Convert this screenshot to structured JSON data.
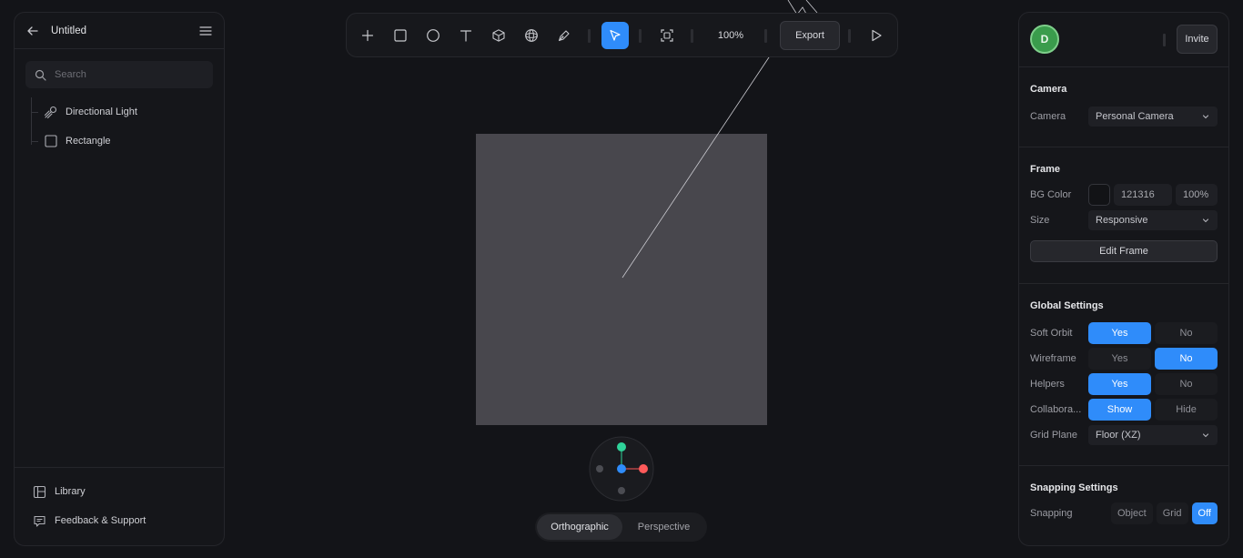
{
  "left_panel": {
    "title": "Untitled",
    "search_placeholder": "Search",
    "tree": [
      {
        "label": "Directional Light",
        "icon": "directional-light-icon"
      },
      {
        "label": "Rectangle",
        "icon": "rectangle-icon"
      }
    ],
    "footer": [
      {
        "label": "Library",
        "icon": "library-icon"
      },
      {
        "label": "Feedback & Support",
        "icon": "feedback-icon"
      }
    ]
  },
  "toolbar": {
    "tools": [
      "add-icon",
      "rectangle-tool-icon",
      "ellipse-tool-icon",
      "text-tool-icon",
      "cube-tool-icon",
      "sphere-tool-icon",
      "pen-tool-icon",
      "select-tool-icon",
      "frame-tool-icon"
    ],
    "active_tool": "select-tool-icon",
    "zoom": "100%",
    "export_label": "Export",
    "play_icon": "play-icon"
  },
  "canvas": {
    "plane_color": "#48474d",
    "background": "#131418",
    "view_modes": [
      "Orthographic",
      "Perspective"
    ],
    "active_view": "Orthographic",
    "gizmo_colors": {
      "x": "#ff5a5a",
      "y": "#2fd39a",
      "z": "#2f8cfa"
    }
  },
  "right_panel": {
    "avatar_initial": "D",
    "invite_label": "Invite",
    "camera": {
      "title": "Camera",
      "label": "Camera",
      "value": "Personal Camera"
    },
    "frame": {
      "title": "Frame",
      "bg_color_label": "BG Color",
      "bg_color_hex": "121316",
      "bg_opacity": "100%",
      "size_label": "Size",
      "size_value": "Responsive",
      "edit_frame_label": "Edit Frame"
    },
    "global_settings": {
      "title": "Global Settings",
      "rows": [
        {
          "label": "Soft Orbit",
          "options": [
            "Yes",
            "No"
          ],
          "selected": "Yes"
        },
        {
          "label": "Wireframe",
          "options": [
            "Yes",
            "No"
          ],
          "selected": "No"
        },
        {
          "label": "Helpers",
          "options": [
            "Yes",
            "No"
          ],
          "selected": "Yes"
        },
        {
          "label": "Collabora...",
          "options": [
            "Show",
            "Hide"
          ],
          "selected": "Show"
        }
      ],
      "grid_plane_label": "Grid Plane",
      "grid_plane_value": "Floor (XZ)"
    },
    "snapping": {
      "title": "Snapping Settings",
      "label": "Snapping",
      "options": [
        "Object",
        "Grid",
        "Off"
      ],
      "selected": "Off"
    },
    "accent": "#2f8cfa"
  }
}
